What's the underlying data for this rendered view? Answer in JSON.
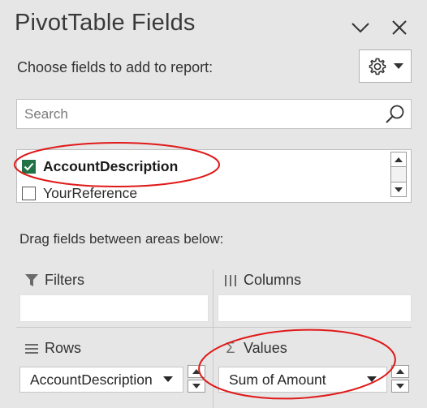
{
  "header": {
    "title": "PivotTable Fields"
  },
  "prompt": {
    "choose_label": "Choose fields to add to report:"
  },
  "search": {
    "placeholder": "Search"
  },
  "fields": [
    {
      "label": "AccountDescription",
      "checked": true
    },
    {
      "label": "YourReference",
      "checked": false
    }
  ],
  "areas": {
    "drag_label": "Drag fields between areas below:",
    "filters_label": "Filters",
    "columns_label": "Columns",
    "rows_label": "Rows",
    "values_label": "Values",
    "rows_item": "AccountDescription",
    "values_item": "Sum of Amount"
  },
  "colors": {
    "check_green": "#217346",
    "annotation_red": "#e01919",
    "pane_bg": "#e6e6e6"
  },
  "icons": [
    "chevron-down-icon",
    "close-icon",
    "gear-icon",
    "dropdown-caret-icon",
    "search-icon",
    "filter-icon",
    "columns-icon",
    "rows-icon",
    "sigma-icon",
    "scroll-up-icon",
    "scroll-down-icon",
    "checkmark-icon"
  ]
}
